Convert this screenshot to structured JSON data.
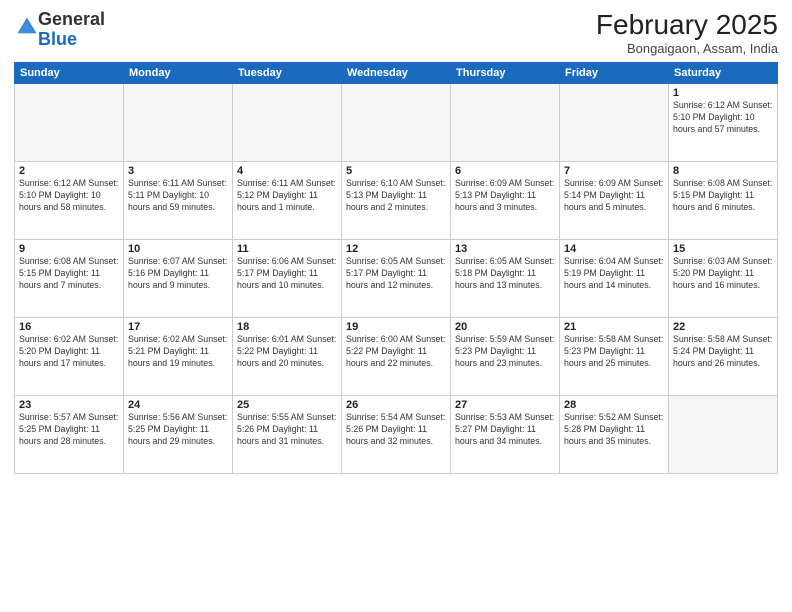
{
  "header": {
    "logo_general": "General",
    "logo_blue": "Blue",
    "month_title": "February 2025",
    "location": "Bongaigaon, Assam, India"
  },
  "days_of_week": [
    "Sunday",
    "Monday",
    "Tuesday",
    "Wednesday",
    "Thursday",
    "Friday",
    "Saturday"
  ],
  "weeks": [
    [
      {
        "day": "",
        "info": ""
      },
      {
        "day": "",
        "info": ""
      },
      {
        "day": "",
        "info": ""
      },
      {
        "day": "",
        "info": ""
      },
      {
        "day": "",
        "info": ""
      },
      {
        "day": "",
        "info": ""
      },
      {
        "day": "1",
        "info": "Sunrise: 6:12 AM\nSunset: 5:10 PM\nDaylight: 10 hours and 57 minutes."
      }
    ],
    [
      {
        "day": "2",
        "info": "Sunrise: 6:12 AM\nSunset: 5:10 PM\nDaylight: 10 hours and 58 minutes."
      },
      {
        "day": "3",
        "info": "Sunrise: 6:11 AM\nSunset: 5:11 PM\nDaylight: 10 hours and 59 minutes."
      },
      {
        "day": "4",
        "info": "Sunrise: 6:11 AM\nSunset: 5:12 PM\nDaylight: 11 hours and 1 minute."
      },
      {
        "day": "5",
        "info": "Sunrise: 6:10 AM\nSunset: 5:13 PM\nDaylight: 11 hours and 2 minutes."
      },
      {
        "day": "6",
        "info": "Sunrise: 6:09 AM\nSunset: 5:13 PM\nDaylight: 11 hours and 3 minutes."
      },
      {
        "day": "7",
        "info": "Sunrise: 6:09 AM\nSunset: 5:14 PM\nDaylight: 11 hours and 5 minutes."
      },
      {
        "day": "8",
        "info": "Sunrise: 6:08 AM\nSunset: 5:15 PM\nDaylight: 11 hours and 6 minutes."
      }
    ],
    [
      {
        "day": "9",
        "info": "Sunrise: 6:08 AM\nSunset: 5:15 PM\nDaylight: 11 hours and 7 minutes."
      },
      {
        "day": "10",
        "info": "Sunrise: 6:07 AM\nSunset: 5:16 PM\nDaylight: 11 hours and 9 minutes."
      },
      {
        "day": "11",
        "info": "Sunrise: 6:06 AM\nSunset: 5:17 PM\nDaylight: 11 hours and 10 minutes."
      },
      {
        "day": "12",
        "info": "Sunrise: 6:05 AM\nSunset: 5:17 PM\nDaylight: 11 hours and 12 minutes."
      },
      {
        "day": "13",
        "info": "Sunrise: 6:05 AM\nSunset: 5:18 PM\nDaylight: 11 hours and 13 minutes."
      },
      {
        "day": "14",
        "info": "Sunrise: 6:04 AM\nSunset: 5:19 PM\nDaylight: 11 hours and 14 minutes."
      },
      {
        "day": "15",
        "info": "Sunrise: 6:03 AM\nSunset: 5:20 PM\nDaylight: 11 hours and 16 minutes."
      }
    ],
    [
      {
        "day": "16",
        "info": "Sunrise: 6:02 AM\nSunset: 5:20 PM\nDaylight: 11 hours and 17 minutes."
      },
      {
        "day": "17",
        "info": "Sunrise: 6:02 AM\nSunset: 5:21 PM\nDaylight: 11 hours and 19 minutes."
      },
      {
        "day": "18",
        "info": "Sunrise: 6:01 AM\nSunset: 5:22 PM\nDaylight: 11 hours and 20 minutes."
      },
      {
        "day": "19",
        "info": "Sunrise: 6:00 AM\nSunset: 5:22 PM\nDaylight: 11 hours and 22 minutes."
      },
      {
        "day": "20",
        "info": "Sunrise: 5:59 AM\nSunset: 5:23 PM\nDaylight: 11 hours and 23 minutes."
      },
      {
        "day": "21",
        "info": "Sunrise: 5:58 AM\nSunset: 5:23 PM\nDaylight: 11 hours and 25 minutes."
      },
      {
        "day": "22",
        "info": "Sunrise: 5:58 AM\nSunset: 5:24 PM\nDaylight: 11 hours and 26 minutes."
      }
    ],
    [
      {
        "day": "23",
        "info": "Sunrise: 5:57 AM\nSunset: 5:25 PM\nDaylight: 11 hours and 28 minutes."
      },
      {
        "day": "24",
        "info": "Sunrise: 5:56 AM\nSunset: 5:25 PM\nDaylight: 11 hours and 29 minutes."
      },
      {
        "day": "25",
        "info": "Sunrise: 5:55 AM\nSunset: 5:26 PM\nDaylight: 11 hours and 31 minutes."
      },
      {
        "day": "26",
        "info": "Sunrise: 5:54 AM\nSunset: 5:26 PM\nDaylight: 11 hours and 32 minutes."
      },
      {
        "day": "27",
        "info": "Sunrise: 5:53 AM\nSunset: 5:27 PM\nDaylight: 11 hours and 34 minutes."
      },
      {
        "day": "28",
        "info": "Sunrise: 5:52 AM\nSunset: 5:28 PM\nDaylight: 11 hours and 35 minutes."
      },
      {
        "day": "",
        "info": ""
      }
    ]
  ]
}
